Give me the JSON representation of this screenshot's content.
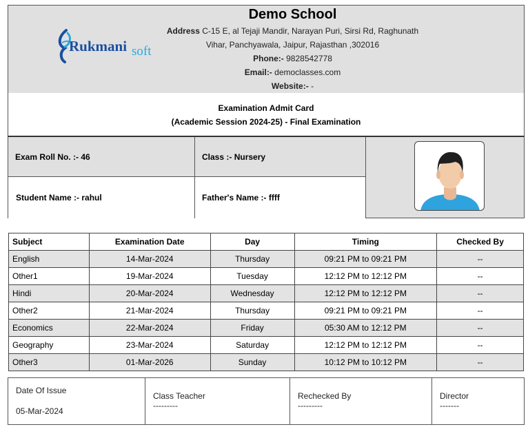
{
  "school": {
    "name": "Demo School",
    "address_label": "Address",
    "address_line1": "C-15 E, al Tejaji Mandir, Narayan Puri, Sirsi Rd, Raghunath",
    "address_line2": "Vihar, Panchyawala, Jaipur, Rajasthan ,302016",
    "phone_label": "Phone:-",
    "phone": "9828542778",
    "email_label": "Email:-",
    "email": "democlasses.com",
    "website_label": "Website:-",
    "website": "-"
  },
  "logo": {
    "text_main": "Rukmani",
    "text_sub": "soft",
    "icon": "rukmanisoft-logo-icon",
    "color_main": "#1b4fa0",
    "color_sub": "#29a8e0"
  },
  "card": {
    "title": "Examination Admit Card",
    "session": "(Academic Session 2024-25) - Final Examination"
  },
  "student": {
    "roll_label": "Exam Roll No. :-",
    "roll": "46",
    "class_label": "Class :-",
    "class": "Nursery",
    "name_label": "Student Name :-",
    "name": "rahul",
    "father_label": "Father's Name :-",
    "father": "ffff",
    "photo_icon": "avatar-placeholder-icon"
  },
  "table": {
    "headers": [
      "Subject",
      "Examination Date",
      "Day",
      "Timing",
      "Checked By"
    ],
    "rows": [
      [
        "English",
        "14-Mar-2024",
        "Thursday",
        "09:21 PM to 09:21 PM",
        "--"
      ],
      [
        "Other1",
        "19-Mar-2024",
        "Tuesday",
        "12:12 PM to 12:12 PM",
        "--"
      ],
      [
        "Hindi",
        "20-Mar-2024",
        "Wednesday",
        "12:12 PM to 12:12 PM",
        "--"
      ],
      [
        "Other2",
        "21-Mar-2024",
        "Thursday",
        "09:21 PM to 09:21 PM",
        "--"
      ],
      [
        "Economics",
        "22-Mar-2024",
        "Friday",
        "05:30 AM to 12:12 PM",
        "--"
      ],
      [
        "Geography",
        "23-Mar-2024",
        "Saturday",
        "12:12 PM to 12:12 PM",
        "--"
      ],
      [
        "Other3",
        "01-Mar-2026",
        "Sunday",
        "10:12 PM to 10:12 PM",
        "--"
      ]
    ]
  },
  "footer": {
    "issue_label": "Date Of Issue",
    "issue_date": "05-Mar-2024",
    "class_teacher": "Class Teacher",
    "class_teacher_sign": "---------",
    "rechecked": "Rechecked By",
    "rechecked_sign": "---------",
    "director": "Director",
    "director_sign": "-------"
  }
}
